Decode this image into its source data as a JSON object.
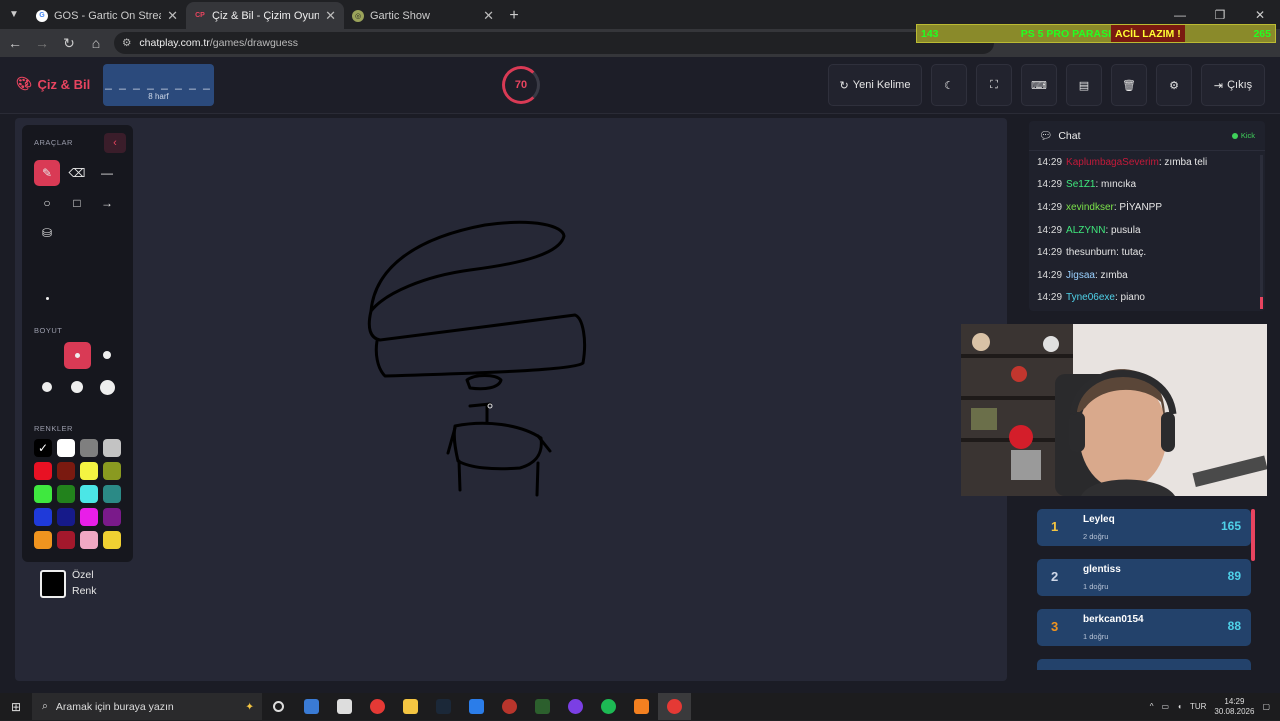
{
  "browser": {
    "tabs": [
      {
        "title": "GOS - Gartic On Stream",
        "favicon": "G",
        "color": "#4285f4",
        "active": false
      },
      {
        "title": "Çiz & Bil - Çizim Oyunu",
        "favicon": "CP",
        "color": "#e8445f",
        "active": true
      },
      {
        "title": "Gartic Show",
        "favicon": "◎",
        "color": "#9aa35a",
        "active": false
      }
    ],
    "url_host": "chatplay.com.tr",
    "url_path": "/games/drawguess"
  },
  "ticker": {
    "left": "143",
    "middle": "PS 5 PRO PARASI",
    "highlight": "ACİL LAZIM !",
    "right": "265"
  },
  "app": {
    "logo": "Çiz & Bil",
    "word_dashes": "_ _ _ _ _ _ _ _",
    "word_length": "8 harf",
    "timer": "70",
    "new_word": "Yeni Kelime",
    "exit": "Çıkış"
  },
  "tools": {
    "title": "ARAÇLAR",
    "size_title": "BOYUT",
    "colors_title": "RENKLER",
    "custom_color": "Özel",
    "custom_color2": "Renk",
    "palette": [
      "#000000",
      "#ffffff",
      "#7f7f7f",
      "#c3c3c3",
      "#e81123",
      "#7a1a10",
      "#f4f442",
      "#8a9a20",
      "#3fe83f",
      "#22821c",
      "#4be6e6",
      "#2b8a86",
      "#1f3ad9",
      "#161a8a",
      "#e81ee8",
      "#7a1a8a",
      "#f0941f",
      "#a3182c",
      "#f0a8c4",
      "#f0d032"
    ],
    "selected_color": "#000000"
  },
  "chat": {
    "title": "Chat",
    "platform": "Kick",
    "messages": [
      {
        "time": "14:29",
        "user": "KaplumbagaSeverim",
        "text": ": zımba teli",
        "color": "#c41a3a"
      },
      {
        "time": "14:29",
        "user": "Se1Z1",
        "text": ": mıncıka",
        "color": "#3fe87c"
      },
      {
        "time": "14:29",
        "user": "xevindkser",
        "text": ": PİYANPP",
        "color": "#7be24a"
      },
      {
        "time": "14:29",
        "user": "ALZYNN",
        "text": ": pusula",
        "color": "#3fe87c"
      },
      {
        "time": "14:29",
        "user": "thesunburn",
        "text": ": tutaç.",
        "color": "#e6e6e6"
      },
      {
        "time": "14:29",
        "user": "Jigsaa",
        "text": ": zımba",
        "color": "#9ad1ff"
      },
      {
        "time": "14:29",
        "user": "Tyne06exe",
        "text": ": piano",
        "color": "#4fd1e8"
      }
    ]
  },
  "leaderboard": [
    {
      "rank": "1",
      "name": "Leyleq",
      "correct": "2 doğru",
      "score": "165",
      "rank_color": "#f4c542"
    },
    {
      "rank": "2",
      "name": "glentiss",
      "correct": "1 doğru",
      "score": "89",
      "rank_color": "#cfd8e8"
    },
    {
      "rank": "3",
      "name": "berkcan0154",
      "correct": "1 doğru",
      "score": "88",
      "rank_color": "#f0941f"
    }
  ],
  "taskbar": {
    "search_placeholder": "Aramak için buraya yazın",
    "lang": "TUR",
    "time": "14:29",
    "date": "30.08.2026"
  }
}
